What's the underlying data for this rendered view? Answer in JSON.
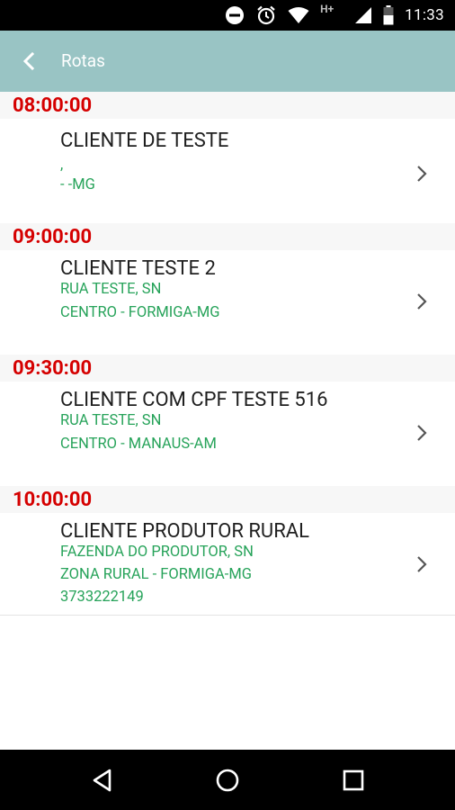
{
  "status_bar": {
    "time": "11:33",
    "icons": [
      "do-not-disturb-icon",
      "alarm-icon",
      "wifi-icon",
      "network-hplus-icon",
      "signal-icon",
      "battery-icon"
    ],
    "network_label": "H+"
  },
  "app_bar": {
    "title": "Rotas",
    "back_icon": "back-arrow-icon",
    "background_color": "#99c4c4"
  },
  "colors": {
    "time_header": "#d50000",
    "address": "#27a35a",
    "client_name": "#1f1f1f"
  },
  "routes": [
    {
      "time": "08:00:00",
      "client": "CLIENTE DE TESTE",
      "address_line1": ",",
      "address_line2": "- -MG",
      "phone": ""
    },
    {
      "time": "09:00:00",
      "client": "CLIENTE TESTE 2",
      "address_line1": "RUA TESTE, SN",
      "address_line2": "CENTRO - FORMIGA-MG",
      "phone": ""
    },
    {
      "time": "09:30:00",
      "client": "CLIENTE COM CPF TESTE 516",
      "address_line1": "RUA TESTE, SN",
      "address_line2": "CENTRO - MANAUS-AM",
      "phone": ""
    },
    {
      "time": "10:00:00",
      "client": "CLIENTE PRODUTOR RURAL",
      "address_line1": "FAZENDA DO PRODUTOR, SN",
      "address_line2": "ZONA RURAL - FORMIGA-MG",
      "phone": "3733222149"
    }
  ],
  "nav_bar": {
    "buttons": [
      "back-triangle-icon",
      "home-circle-icon",
      "recents-square-icon"
    ]
  }
}
